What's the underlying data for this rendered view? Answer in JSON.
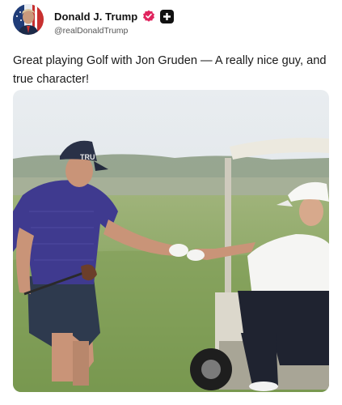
{
  "post": {
    "author": {
      "display_name": "Donald J. Trump",
      "handle": "@realDonaldTrump",
      "avatar_icon": "avatar-portrait",
      "verified_icon": "verified-badge-icon",
      "verified_color": "#e0245e",
      "badge_icon": "plus-badge-icon"
    },
    "text": "Great playing Golf with Jon Gruden — A really nice guy, and true character!",
    "media": {
      "type": "photo",
      "cap_text": "TRU"
    }
  }
}
